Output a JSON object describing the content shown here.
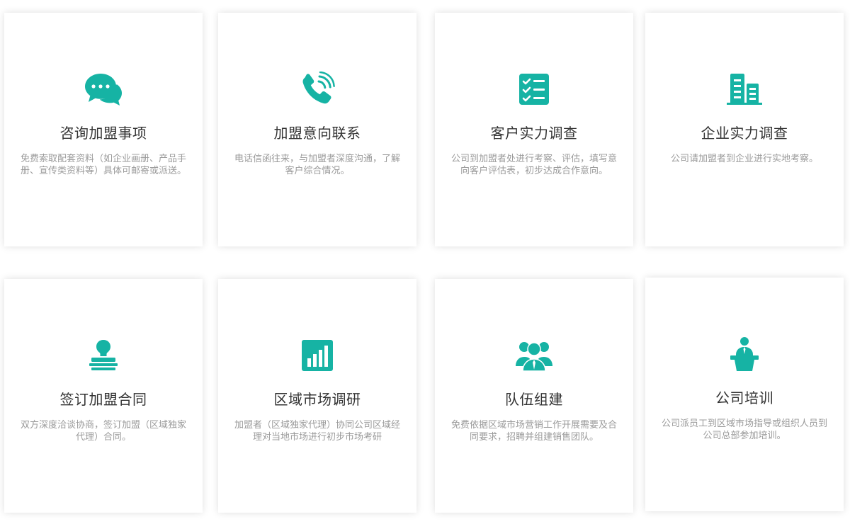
{
  "accent_color": "#16b3a4",
  "cards": [
    {
      "icon": "chat-bubbles-icon",
      "title": "咨询加盟事项",
      "desc": "免费索取配套资料（如企业画册、产品手册、宣传类资料等）具体可邮寄或派送。"
    },
    {
      "icon": "phone-call-icon",
      "title": "加盟意向联系",
      "desc": "电话信函往来，与加盟者深度沟通，了解客户综合情况。"
    },
    {
      "icon": "checklist-icon",
      "title": "客户实力调查",
      "desc": "公司到加盟者处进行考察、评估，填写意向客户评估表，初步达成合作意向。"
    },
    {
      "icon": "buildings-icon",
      "title": "企业实力调查",
      "desc": "公司请加盟者到企业进行实地考察。"
    },
    {
      "icon": "stamp-icon",
      "title": "签订加盟合同",
      "desc": "双方深度洽谈协商，签订加盟（区域独家代理）合同。"
    },
    {
      "icon": "bar-chart-icon",
      "title": "区域市场调研",
      "desc": "加盟者（区域独家代理）协同公司区域经理对当地市场进行初步市场考研"
    },
    {
      "icon": "team-icon",
      "title": "队伍组建",
      "desc": "免费依据区域市场营销工作开展需要及合同要求，招聘并组建销售团队。"
    },
    {
      "icon": "trainer-podium-icon",
      "title": "公司培训",
      "desc": "公司派员工到区域市场指导或组织人员到公司总部参加培训。"
    }
  ]
}
